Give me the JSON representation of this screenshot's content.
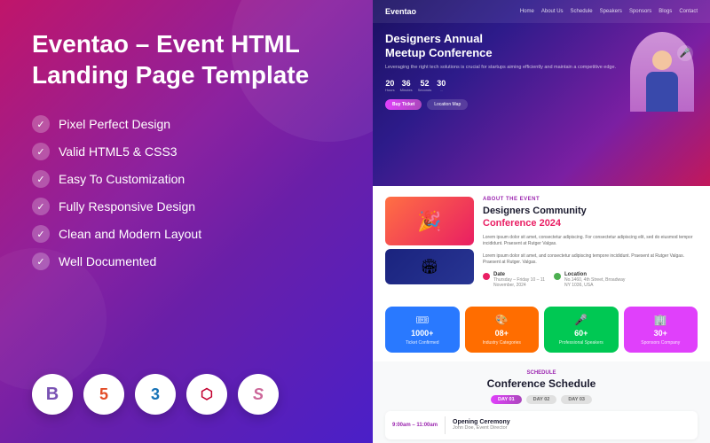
{
  "left": {
    "title": "Eventao – Event HTML\nLanding Page Template",
    "features": [
      "Pixel Perfect Design",
      "Valid HTML5 & CSS3",
      "Easy To Customization",
      "Fully Responsive Design",
      "Clean and Modern Layout",
      "Well Documented"
    ],
    "tech_icons": [
      {
        "id": "bootstrap",
        "symbol": "B",
        "color": "#7952b3",
        "name": "Bootstrap"
      },
      {
        "id": "html5",
        "symbol": "5",
        "color": "#e34c26",
        "name": "HTML5"
      },
      {
        "id": "css3",
        "symbol": "3",
        "color": "#1572b6",
        "name": "CSS3"
      },
      {
        "id": "angular",
        "symbol": "◈",
        "color": "#c3002f",
        "name": "Angular"
      },
      {
        "id": "sass",
        "symbol": "S",
        "color": "#cc6699",
        "name": "Sass"
      }
    ]
  },
  "preview": {
    "nav": {
      "logo": "Eventao",
      "links": [
        "Home",
        "About Us",
        "Schedule",
        "Speakers",
        "Sponsors",
        "Blogs",
        "Contact"
      ]
    },
    "hero": {
      "title": "Designers Annual\nMeetup Conference",
      "desc": "Leveraging the right tech solutions is crucial for startups aiming efficiently and maintain a competitive edge.",
      "countdown": [
        {
          "num": "20",
          "label": "Hours"
        },
        {
          "num": "36",
          "label": "Minutes"
        },
        {
          "num": "52",
          "label": "Seconds"
        },
        {
          "num": "30",
          "label": "..."
        }
      ],
      "btn_primary": "Buy Ticket",
      "btn_secondary": "Location Map"
    },
    "about": {
      "label": "About The Event",
      "title": "Designers Community\nConference 2024",
      "year_color": "#e91e63",
      "text1": "Lorem ipsum dolor sit amet, consectetur adipiscing. For consectetur adipiscing elit, sed do eiusmod tempor incididunt. Praesent at Rutger Valgas.",
      "text2": "Lorem ipsum dolor sit amet, and consectetur adipiscing tempore incididunt. Praesent at Rutger Valgas. Praesent at Rutger. Valgas.",
      "info": [
        {
          "dot_color": "pink",
          "title": "Date",
          "desc": "Thursday – Friday 10 – 11\nNovember, 2024"
        },
        {
          "dot_color": "green",
          "title": "Location",
          "desc": "No.1460, 4th Street, Broadway\nNY 1036, USA"
        }
      ]
    },
    "stats": [
      {
        "color": "blue",
        "icon": "🎟",
        "number": "1000+",
        "label": "Ticket Confirmed"
      },
      {
        "color": "orange",
        "icon": "🎨",
        "number": "08+",
        "label": "Industry Categories"
      },
      {
        "color": "green",
        "icon": "🎤",
        "number": "60+",
        "label": "Professional Speakers"
      },
      {
        "color": "pink",
        "icon": "🏢",
        "number": "30+",
        "label": "Sponsors Company"
      }
    ],
    "schedule": {
      "label": "Schedule",
      "title": "Conference Schedule",
      "days": [
        {
          "label": "DAY 01",
          "active": true
        },
        {
          "label": "DAY 02",
          "active": false
        },
        {
          "label": "DAY 03",
          "active": false
        }
      ],
      "event": {
        "time": "9:00am – 11:00am",
        "name": "Opening Ceremony",
        "speaker": "John Doe, Event Director"
      }
    }
  }
}
